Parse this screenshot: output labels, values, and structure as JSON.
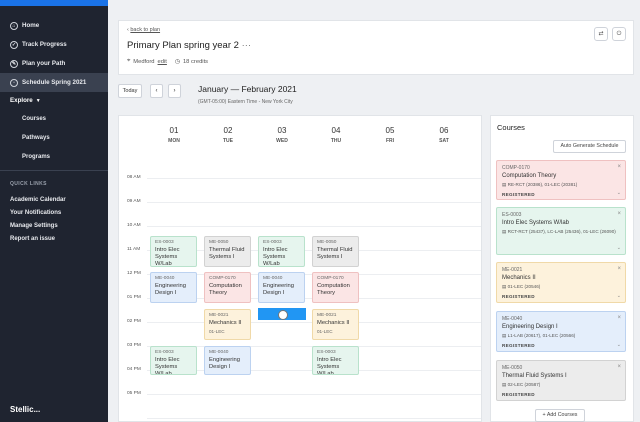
{
  "sidebar": {
    "items": [
      {
        "label": "Home",
        "icon": "home-icon"
      },
      {
        "label": "Track Progress",
        "icon": "check-circle-icon"
      },
      {
        "label": "Plan your Path",
        "icon": "pencil-icon"
      },
      {
        "label": "Schedule Spring 2021",
        "icon": "calendar-icon"
      }
    ],
    "explore_label": "Explore",
    "explore_items": [
      "Courses",
      "Pathways",
      "Programs"
    ],
    "quick_links_label": "QUICK LINKS",
    "quick_links": [
      "Academic Calendar",
      "Your Notifications",
      "Manage Settings",
      "Report an issue"
    ],
    "brand": "Stellic..."
  },
  "header": {
    "back_label": "back to plan",
    "title": "Primary Plan spring year 2",
    "title_menu": "···",
    "campus": "Medford",
    "edit_label": "edit",
    "credits": "18 credits"
  },
  "toolbar": {
    "today_label": "Today",
    "prev": "‹",
    "next": "›",
    "month": "January — February 2021",
    "timezone": "(GMT-05:00) Eastern Time - New York City"
  },
  "calendar": {
    "days": [
      {
        "num": "01",
        "dow": "MON"
      },
      {
        "num": "02",
        "dow": "TUE"
      },
      {
        "num": "03",
        "dow": "WED"
      },
      {
        "num": "04",
        "dow": "THU"
      },
      {
        "num": "05",
        "dow": "FRI"
      },
      {
        "num": "06",
        "dow": "SAT"
      }
    ],
    "times": [
      "08 AM",
      "09 AM",
      "10 AM",
      "11 AM",
      "12 PM",
      "01 PM",
      "02 PM",
      "03 PM",
      "04 PM",
      "05 PM"
    ],
    "events": [
      {
        "code": "ES-0003",
        "name": "Intro Elec Systems W/Lab",
        "sec": "",
        "color": "green"
      },
      {
        "code": "ME-0050",
        "name": "Thermal Fluid Systems I",
        "sec": "",
        "color": "gray"
      },
      {
        "code": "ES-0003",
        "name": "Intro Elec Systems W/Lab",
        "sec": "",
        "color": "green"
      },
      {
        "code": "ME-0050",
        "name": "Thermal Fluid Systems I",
        "sec": "",
        "color": "gray"
      },
      {
        "code": "ME-0040",
        "name": "Engineering Design I",
        "sec": "",
        "color": "blue"
      },
      {
        "code": "COMP-0170",
        "name": "Computation Theory",
        "sec": "",
        "color": "red"
      },
      {
        "code": "ME-0040",
        "name": "Engineering Design I",
        "sec": "",
        "color": "blue"
      },
      {
        "code": "COMP-0170",
        "name": "Computation Theory",
        "sec": "",
        "color": "red"
      },
      {
        "code": "ME-0021",
        "name": "Mechanics II",
        "sec": "01-LEC",
        "color": "yellow"
      },
      {
        "code": "ME-0021",
        "name": "Mechanics II",
        "sec": "01-LEC",
        "color": "yellow"
      },
      {
        "code": "ES-0003",
        "name": "Intro Elec Systems W/Lab",
        "sec": "",
        "color": "green"
      },
      {
        "code": "ME-0040",
        "name": "Engineering Design I",
        "sec": "",
        "color": "blue"
      },
      {
        "code": "ES-0003",
        "name": "Intro Elec Systems W/Lab",
        "sec": "",
        "color": "green"
      }
    ]
  },
  "courses": {
    "title": "Courses",
    "auto_label": "Auto Generate Schedule",
    "add_label": "+ Add Courses",
    "items": [
      {
        "code": "COMP-0170",
        "name": "Computation Theory",
        "sec": "RE-RCT (20386), 01-LEC (20381)",
        "status": "REGISTERED",
        "color": "red"
      },
      {
        "code": "ES-0003",
        "name": "Intro Elec Systems W/lab",
        "sec": "RCT-RCT (25437), LC-LAB (25436), 01-LEC (26090)",
        "status": "REGISTERED",
        "color": "green"
      },
      {
        "code": "ME-0021",
        "name": "Mechanics II",
        "sec": "01-LEC (20546)",
        "status": "REGISTERED",
        "color": "yellow"
      },
      {
        "code": "ME-0040",
        "name": "Engineering Design I",
        "sec": "L1-LAB (20617), 01-LEC (20566)",
        "status": "REGISTERED",
        "color": "blue"
      },
      {
        "code": "ME-0050",
        "name": "Thermal Fluid Systems I",
        "sec": "02-LEC (20587)",
        "status": "REGISTERED",
        "color": "gray"
      }
    ]
  }
}
